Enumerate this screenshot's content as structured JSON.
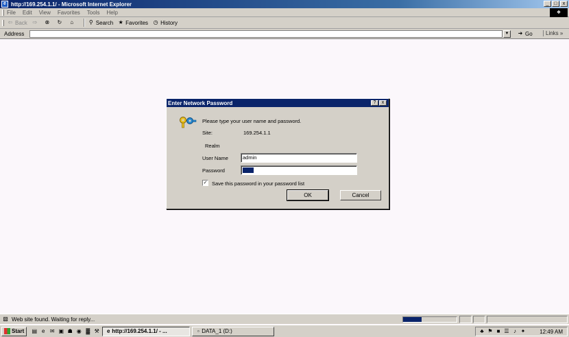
{
  "window": {
    "title": "http://169.254.1.1/ - Microsoft Internet Explorer",
    "app_icon": "ie-page-icon",
    "minimize": "_",
    "maximize": "□",
    "close": "x"
  },
  "menubar": {
    "items": [
      "File",
      "Edit",
      "View",
      "Favorites",
      "Tools",
      "Help"
    ]
  },
  "toolbar": {
    "back": "Back",
    "search": "Search",
    "favorites": "Favorites",
    "history": "History"
  },
  "addressbar": {
    "label": "Address",
    "value": "",
    "go": "Go",
    "links": "Links »"
  },
  "dialog": {
    "title": "Enter Network Password",
    "help": "?",
    "close": "x",
    "prompt": "Please type your user name and password.",
    "site_label": "Site:",
    "site_value": "169.254.1.1",
    "realm_label": "Realm",
    "username_label": "User Name",
    "username_value": "admin",
    "password_label": "Password",
    "password_value": "*****",
    "save_password_label": "Save this password in your password list",
    "save_password_checked": true,
    "ok": "OK",
    "cancel": "Cancel"
  },
  "statusbar": {
    "text": "Web site found. Waiting for reply...",
    "progress": 0.35
  },
  "taskbar": {
    "start": "Start",
    "tasks": [
      {
        "label": "http://169.254.1.1/ - ...",
        "active": true
      },
      {
        "label": "DATA_1 (D:)",
        "active": false
      }
    ],
    "clock": "12:49 AM"
  }
}
